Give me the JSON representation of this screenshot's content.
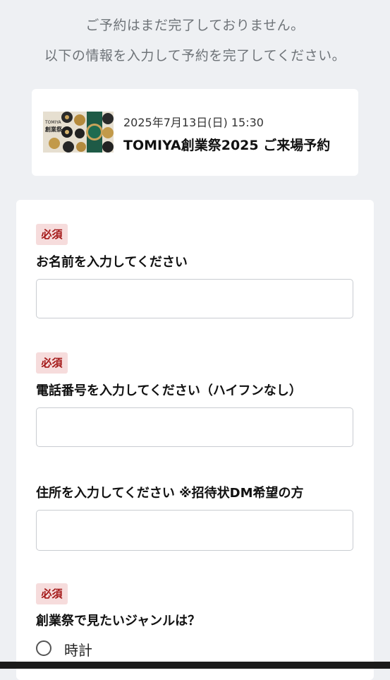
{
  "notice": {
    "line1": "ご予約はまだ完了しておりません。",
    "line2": "以下の情報を入力して予約を完了してください。"
  },
  "event": {
    "thumb_brand": "TOMIYA",
    "thumb_title": "創業祭",
    "date": "2025年7月13日(日) 15:30",
    "title": "TOMIYA創業祭2025 ご来場予約"
  },
  "form": {
    "required_badge": "必須",
    "name": {
      "label": "お名前を入力してください",
      "value": ""
    },
    "phone": {
      "label": "電話番号を入力してください（ハイフンなし）",
      "value": ""
    },
    "address": {
      "label": "住所を入力してください ※招待状DM希望の方",
      "value": ""
    },
    "genre": {
      "label": "創業祭で見たいジャンルは？",
      "options": [
        "時計"
      ]
    }
  },
  "colors": {
    "page_bg": "#eef0f3",
    "badge_bg": "#f6dcdc",
    "badge_text": "#a31616"
  }
}
